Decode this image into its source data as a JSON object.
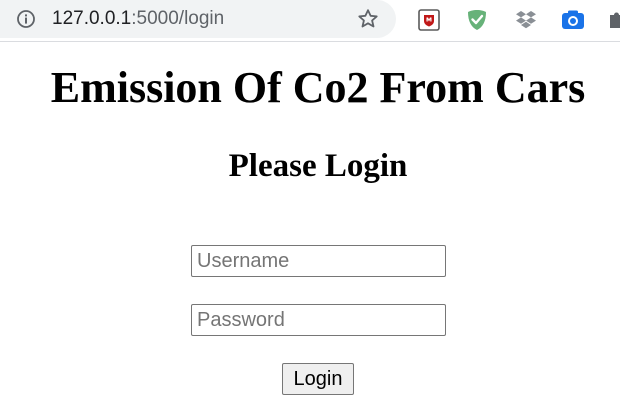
{
  "browser": {
    "url_host": "127.0.0.1",
    "url_rest": ":5000/login",
    "icons": {
      "info": "info-icon",
      "bookmark": "star-icon",
      "extensions": [
        "mcafee-shield-icon",
        "adguard-shield-icon",
        "dropbox-icon",
        "camera-icon",
        "puzzle-icon"
      ]
    },
    "colors": {
      "toolbar_bg": "#f1f3f4",
      "mcafee": "#c01818",
      "adguard": "#67b279",
      "dropbox": "#8a8f95",
      "camera": "#1a73e8"
    }
  },
  "page": {
    "title": "Emission Of Co2 From Cars",
    "subtitle": "Please Login",
    "form": {
      "username_placeholder": "Username",
      "username_value": "",
      "password_placeholder": "Password",
      "password_value": "",
      "submit_label": "Login"
    }
  }
}
